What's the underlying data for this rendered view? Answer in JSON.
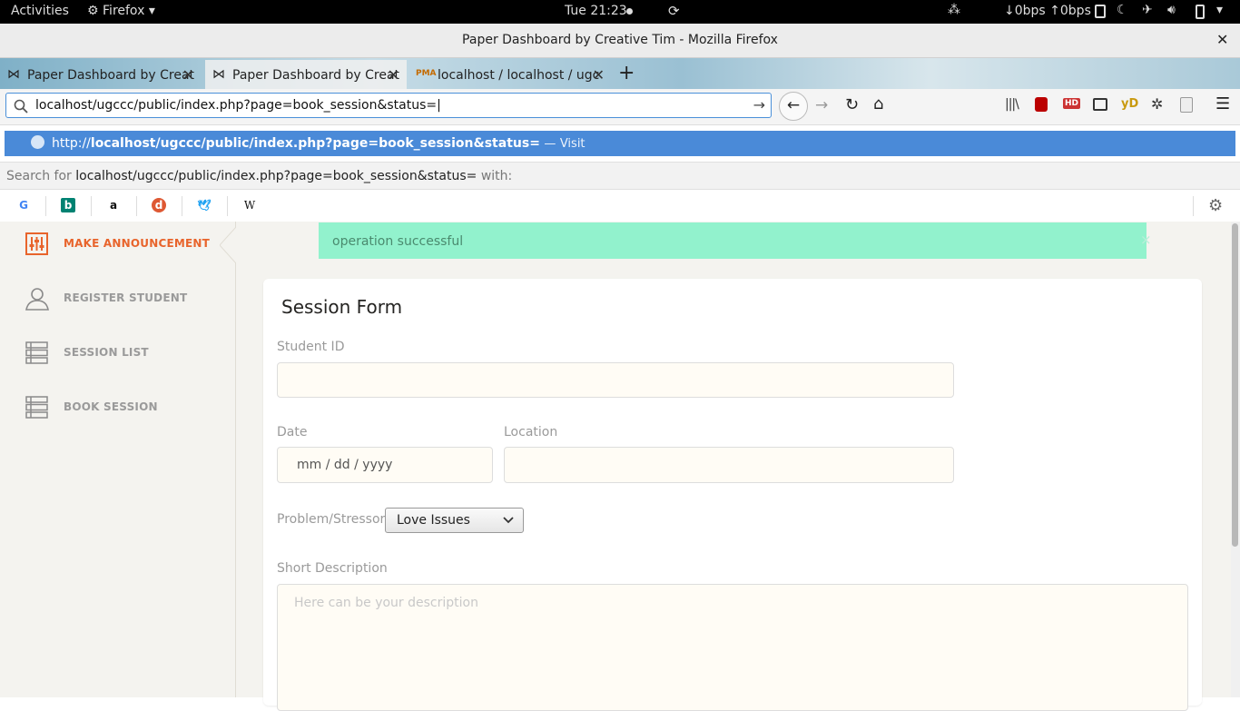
{
  "os": {
    "activities": "Activities",
    "app_menu": "Firefox",
    "clock": "Tue 21:23",
    "net_speed": "↓0bps ↑0bps"
  },
  "window": {
    "title": "Paper Dashboard by Creative Tim - Mozilla Firefox"
  },
  "tabs": [
    {
      "label": "Paper Dashboard by Creat",
      "active": false
    },
    {
      "label": "Paper Dashboard by Creat",
      "active": true
    },
    {
      "label": "localhost / localhost / ugc",
      "active": false
    }
  ],
  "navbar": {
    "url": "localhost/ugccc/public/index.php?page=book_session&status=|"
  },
  "url_dropdown": {
    "suggestion_prefix": "http://",
    "suggestion_url": "localhost/ugccc/public/index.php?page=book_session&status=",
    "suggestion_sep": "—",
    "suggestion_action": "Visit",
    "search_prefix": "Search for",
    "search_query": "localhost/ugccc/public/index.php?page=book_session&status=",
    "search_suffix": "with:",
    "engines": [
      "google-icon",
      "bing-icon",
      "amazon-icon",
      "duckduckgo-icon",
      "twitter-icon",
      "wikipedia-icon"
    ]
  },
  "sidebar": {
    "items": [
      {
        "label": "MAKE ANNOUNCEMENT",
        "active": true
      },
      {
        "label": "REGISTER STUDENT",
        "active": false
      },
      {
        "label": "SESSION LIST",
        "active": false
      },
      {
        "label": "BOOK SESSION",
        "active": false
      }
    ]
  },
  "alert": {
    "message": "operation successful",
    "close": "×"
  },
  "form": {
    "title": "Session Form",
    "student_id_label": "Student ID",
    "student_id_value": "",
    "date_label": "Date",
    "date_placeholder": "mm / dd / yyyy",
    "location_label": "Location",
    "location_value": "",
    "problem_label": "Problem/Stressor",
    "problem_selected": "Love Issues",
    "description_label": "Short Description",
    "description_placeholder": "Here can be your description"
  },
  "colors": {
    "accent": "#e8642c",
    "alert_bg": "#92f2cd",
    "url_highlight": "#4a8ad8"
  }
}
